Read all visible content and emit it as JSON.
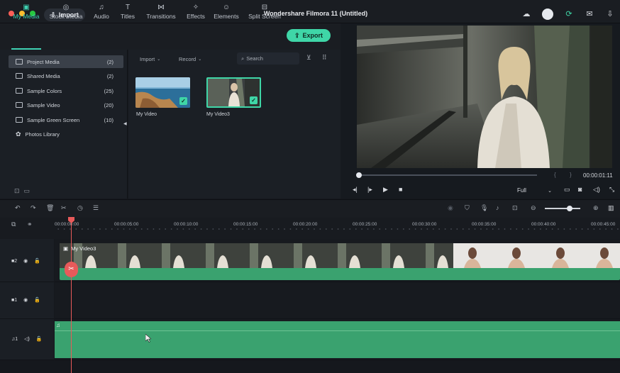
{
  "window": {
    "title": "Wondershare Filmora 11 (Untitled)",
    "import_label": "Import",
    "traffic_colors": [
      "#ff5f57",
      "#febc2e",
      "#28c840"
    ]
  },
  "media_tabs": [
    {
      "label": "My Media",
      "icon": "my-media-icon",
      "active": true
    },
    {
      "label": "Stock Media",
      "icon": "stock-media-icon"
    },
    {
      "label": "Audio",
      "icon": "audio-icon"
    },
    {
      "label": "Titles",
      "icon": "titles-icon"
    },
    {
      "label": "Transitions",
      "icon": "transitions-icon"
    },
    {
      "label": "Effects",
      "icon": "effects-icon"
    },
    {
      "label": "Elements",
      "icon": "elements-icon"
    },
    {
      "label": "Split Screen",
      "icon": "split-screen-icon"
    }
  ],
  "export_label": "Export",
  "sidebar": {
    "items": [
      {
        "label": "Project Media",
        "count": "(2)",
        "active": true
      },
      {
        "label": "Shared Media",
        "count": "(2)"
      },
      {
        "label": "Sample Colors",
        "count": "(25)"
      },
      {
        "label": "Sample Video",
        "count": "(20)"
      },
      {
        "label": "Sample Green Screen",
        "count": "(10)"
      },
      {
        "label": "Photos Library",
        "count": ""
      }
    ]
  },
  "media": {
    "import_dropdown": "Import",
    "record_dropdown": "Record",
    "search_placeholder": "Search",
    "items": [
      {
        "name": "My Video"
      },
      {
        "name": "My Video3"
      }
    ]
  },
  "preview": {
    "timecode": "00:00:01:11",
    "quality": "Full",
    "progress": 0.01
  },
  "timeline": {
    "ruler": [
      "00:00:00:00",
      "00:00:05:00",
      "00:00:10:00",
      "00:00:15:00",
      "00:00:20:00",
      "00:00:25:00",
      "00:00:30:00",
      "00:00:35:00",
      "00:00:40:00",
      "00:00:45:00"
    ],
    "tracks": [
      {
        "id": "2",
        "type": "video",
        "clip": "My Video3"
      },
      {
        "id": "1",
        "type": "video"
      },
      {
        "id": "1",
        "type": "audio"
      }
    ],
    "zoom": 0.7,
    "accent": "#3fd6a7",
    "clip_color": "#3aa26f",
    "playhead_color": "#e85a5a"
  }
}
